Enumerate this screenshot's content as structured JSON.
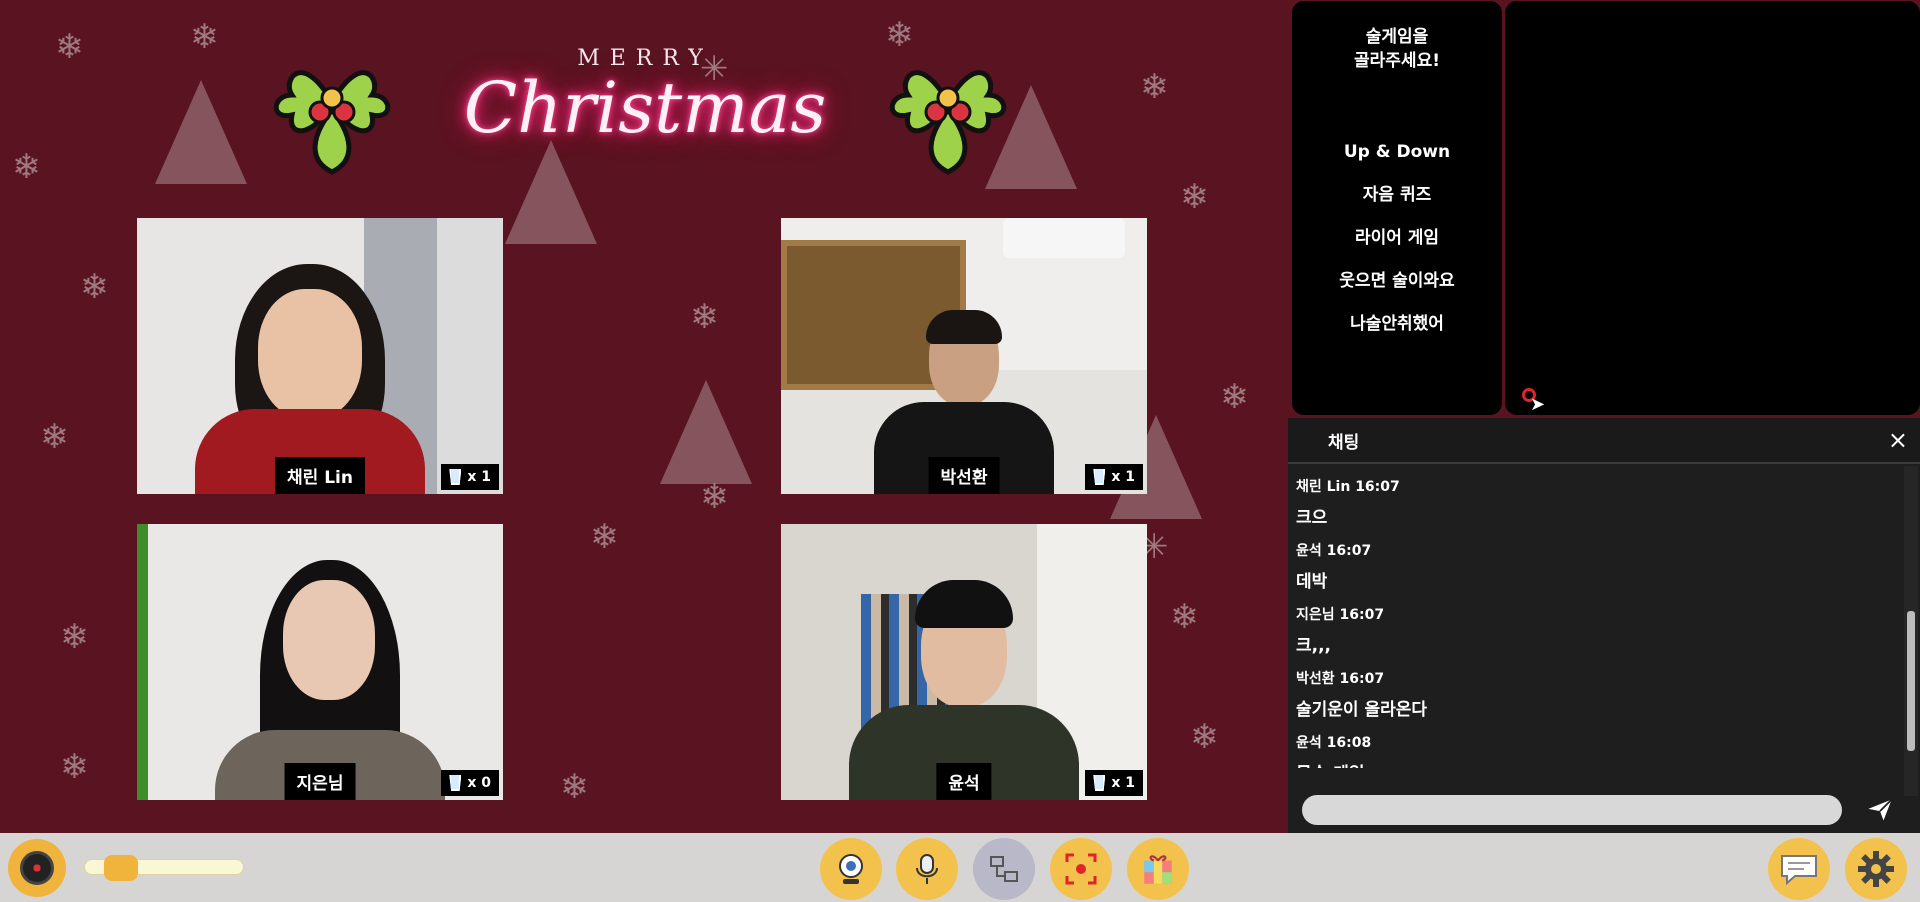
{
  "stage": {
    "merry": "MERRY",
    "christmas": "Christmas"
  },
  "participants": [
    {
      "name": "채린 Lin",
      "cups": "x 1"
    },
    {
      "name": "박선환",
      "cups": "x 1"
    },
    {
      "name": "지은님",
      "cups": "x 0"
    },
    {
      "name": "윤석",
      "cups": "x 1"
    }
  ],
  "game_menu": {
    "prompt_line1": "술게임을",
    "prompt_line2": "골라주세요!",
    "items": [
      "Up & Down",
      "자음 퀴즈",
      "라이어 게임",
      "웃으면 술이와요",
      "나술안취했어"
    ]
  },
  "chat": {
    "title": "채팅",
    "close_icon": "×",
    "messages": [
      {
        "meta": "채린 Lin  16:07",
        "text": "크으"
      },
      {
        "meta": "윤석  16:07",
        "text": "데박"
      },
      {
        "meta": "지은님  16:07",
        "text": "크,,,"
      },
      {
        "meta": "박선환  16:07",
        "text": "술기운이 올라온다"
      },
      {
        "meta": "윤석  16:08",
        "text": "무슨 게임"
      }
    ],
    "input_placeholder": "",
    "send_icon": "paper-plane"
  },
  "toolbar": {
    "music_icon": "vinyl-record",
    "volume_level": 0.15,
    "buttons": [
      "webcam-icon",
      "microphone-icon",
      "layout-icon",
      "face-capture-icon",
      "gift-box-icon"
    ],
    "right_buttons": [
      "chat-bubble-icon",
      "gear-icon"
    ]
  },
  "colors": {
    "stage_bg": "#5a1320",
    "accent": "#f2c24d",
    "neon_pink": "#ff2d7e"
  }
}
